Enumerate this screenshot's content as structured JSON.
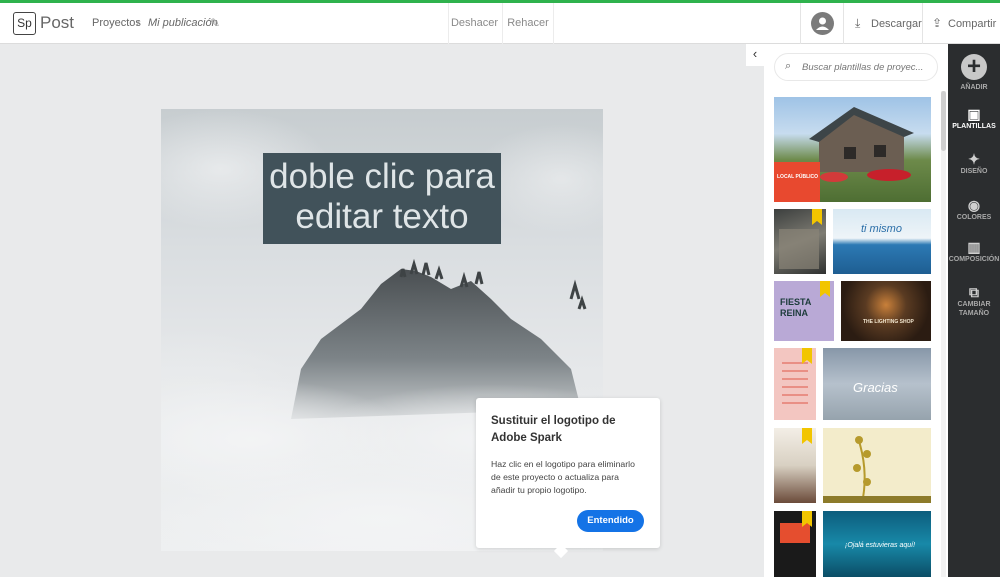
{
  "header": {
    "logo": "Sp",
    "app_name": "Post",
    "breadcrumb_projects": "Proyectos",
    "breadcrumb_separator": "›",
    "breadcrumb_current": "Mi publicación",
    "undo": "Deshacer",
    "redo": "Rehacer",
    "download": "Descargar",
    "share": "Compartir",
    "accent_color": "#2fb24d"
  },
  "canvas": {
    "headline": "doble clic para editar texto",
    "headline_bg": "#41525a"
  },
  "popup": {
    "title": "Sustituir el logotipo de Adobe Spark",
    "text": "Haz clic en el logotipo para eliminarlo de este proyecto o actualiza para añadir tu propio logotipo.",
    "button": "Entendido",
    "button_color": "#1473e6"
  },
  "templates_panel": {
    "search_placeholder": "Buscar plantillas de proyec...",
    "templates": [
      {
        "name": "local-publico",
        "text": "LOCAL PÚBLICO"
      },
      {
        "name": "dark-interior",
        "text": ""
      },
      {
        "name": "ti-mismo",
        "text": "ti mismo"
      },
      {
        "name": "fiesta-reina",
        "text": "FIESTA REINA"
      },
      {
        "name": "lighting-shop",
        "text": "THE LIGHTING SHOP"
      },
      {
        "name": "pink-list",
        "text": ""
      },
      {
        "name": "gracias",
        "text": "Gracias"
      },
      {
        "name": "dark-photo",
        "text": ""
      },
      {
        "name": "floral-card",
        "text": ""
      },
      {
        "name": "poster-black",
        "text": ""
      },
      {
        "name": "estaciones",
        "text": "¡Ojalá estuvieras aquí!"
      }
    ]
  },
  "rail": {
    "items": [
      {
        "label": "AÑADIR",
        "icon": "plus-icon"
      },
      {
        "label": "PLANTILLAS",
        "icon": "image-icon"
      },
      {
        "label": "DISEÑO",
        "icon": "magic-wand-icon"
      },
      {
        "label": "COLORES",
        "icon": "palette-icon"
      },
      {
        "label": "COMPOSICIÓN",
        "icon": "layout-icon"
      },
      {
        "label": "CAMBIAR",
        "icon": "resize-icon"
      },
      {
        "label": "TAMAÑO",
        "icon": ""
      }
    ]
  }
}
